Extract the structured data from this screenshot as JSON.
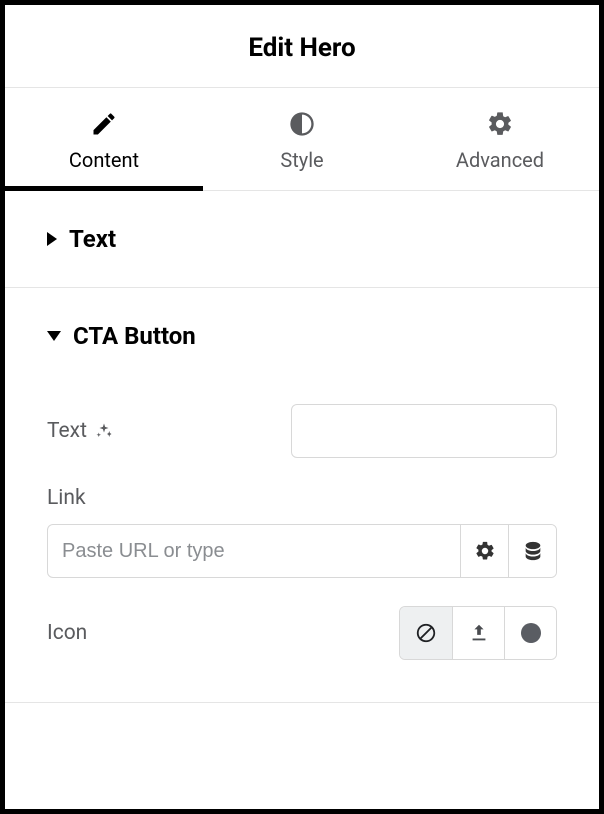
{
  "header": {
    "title": "Edit Hero"
  },
  "tabs": {
    "content": "Content",
    "style": "Style",
    "advanced": "Advanced",
    "active": "content"
  },
  "sections": {
    "text": {
      "title": "Text"
    },
    "cta": {
      "title": "CTA Button",
      "fields": {
        "text_label": "Text",
        "text_value": "",
        "link_label": "Link",
        "link_placeholder": "Paste URL or type",
        "link_value": "",
        "icon_label": "Icon"
      }
    }
  }
}
